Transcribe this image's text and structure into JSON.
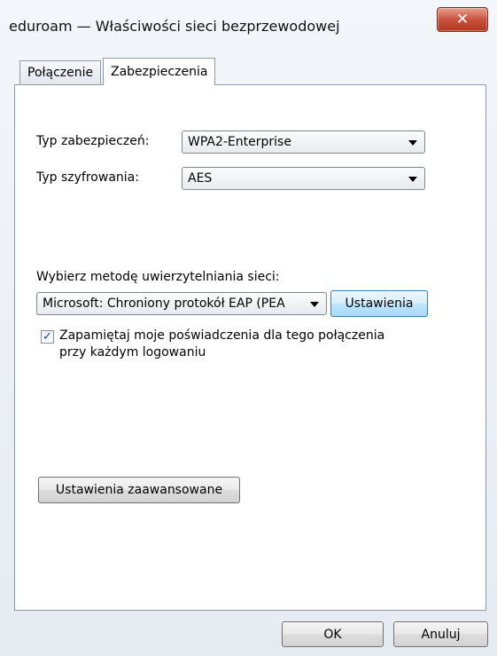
{
  "window": {
    "title": "eduroam — Właściwości sieci bezprzewodowej",
    "close_glyph": "✕"
  },
  "tabs": [
    {
      "label": "Połączenie",
      "active": false
    },
    {
      "label": "Zabezpieczenia",
      "active": true
    }
  ],
  "security": {
    "type_label": "Typ zabezpieczeń:",
    "type_value": "WPA2-Enterprise",
    "encryption_label": "Typ szyfrowania:",
    "encryption_value": "AES",
    "auth_method_label": "Wybierz metodę uwierzytelniania sieci:",
    "auth_method_value": "Microsoft: Chroniony protokół EAP (PEA",
    "settings_button": "Ustawienia",
    "remember_checked": true,
    "remember_label_line1": "Zapamiętaj moje poświadczenia dla tego połączenia",
    "remember_label_line2": "przy każdym logowaniu",
    "advanced_button": "Ustawienia zaawansowane"
  },
  "footer": {
    "ok_button": "OK",
    "cancel_button": "Anuluj"
  },
  "colors": {
    "close_button": "#c8533e",
    "focused_button": "#bee6fd"
  }
}
